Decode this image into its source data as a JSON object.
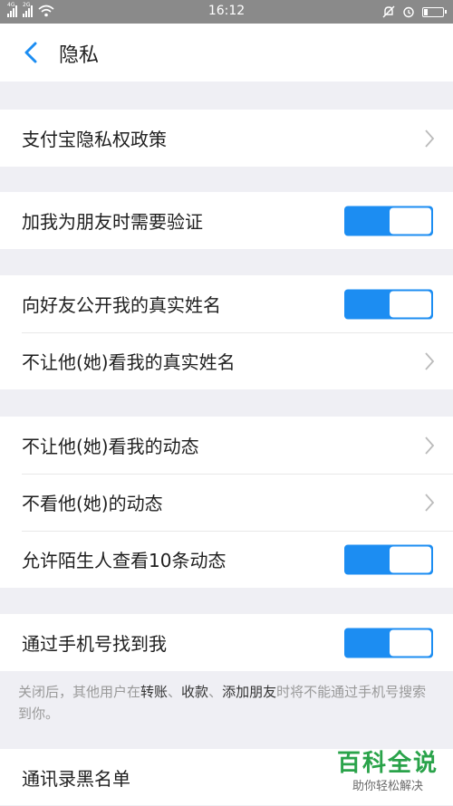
{
  "status": {
    "signal1": "4G",
    "signal2": "2G",
    "time": "16:12"
  },
  "nav": {
    "title": "隐私"
  },
  "rows": {
    "alipay_policy": "支付宝隐私权政策",
    "verify_friend": "加我为朋友时需要验证",
    "show_real_name": "向好友公开我的真实姓名",
    "hide_real_name": "不让他(她)看我的真实姓名",
    "hide_moments": "不让他(她)看我的动态",
    "ignore_moments": "不看他(她)的动态",
    "stranger_moments": "允许陌生人查看10条动态",
    "find_by_phone": "通过手机号找到我",
    "contacts_blacklist": "通讯录黑名单"
  },
  "toggles": {
    "verify_friend": true,
    "show_real_name": true,
    "stranger_moments": true,
    "find_by_phone": true
  },
  "footnote": {
    "part1": "关闭后，其他用户在",
    "transfer": "转账",
    "sep1": "、",
    "collect": "收款",
    "sep2": "、",
    "add_friend": "添加朋友",
    "part2": "时将不能通过手机号搜索到你。"
  },
  "watermark": {
    "title": "百科全说",
    "subtitle": "助你轻松解决"
  },
  "colors": {
    "accent": "#1c8df2",
    "background": "#efeff4",
    "watermark": "#2aa34a"
  }
}
